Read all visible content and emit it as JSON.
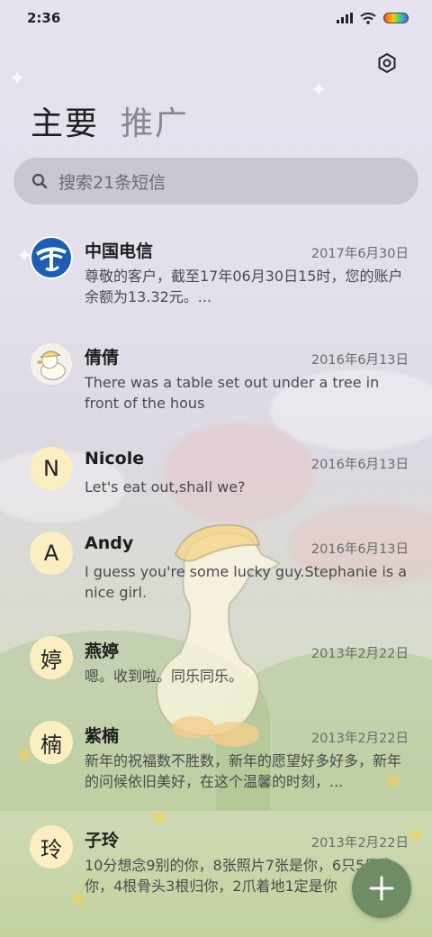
{
  "status_bar": {
    "time": "2:36"
  },
  "tabs": [
    {
      "label": "主要"
    },
    {
      "label": "推广"
    }
  ],
  "search": {
    "placeholder": "搜索21条短信"
  },
  "messages": [
    {
      "avatar_type": "logo",
      "avatar_icon": "china-telecom-logo",
      "name": "中国电信",
      "date": "2017年6月30日",
      "preview": "尊敬的客户，截至17年06月30日15时，您的账户余额为13.32元。..."
    },
    {
      "avatar_type": "picture",
      "avatar_icon": "duck-avatar",
      "name": "倩倩",
      "date": "2016年6月13日",
      "preview": "There was a table set out under a tree in front of the hous"
    },
    {
      "avatar_type": "letter",
      "avatar_letter": "N",
      "name": "Nicole",
      "date": "2016年6月13日",
      "preview": "Let's eat out,shall we?"
    },
    {
      "avatar_type": "letter",
      "avatar_letter": "A",
      "name": "Andy",
      "date": "2016年6月13日",
      "preview": "I guess you're some lucky guy.Stephanie is a nice girl."
    },
    {
      "avatar_type": "letter",
      "avatar_letter": "婷",
      "name": "燕婷",
      "date": "2013年2月22日",
      "preview": "嗯。收到啦。同乐同乐。"
    },
    {
      "avatar_type": "letter",
      "avatar_letter": "楠",
      "name": "紫楠",
      "date": "2013年2月22日",
      "preview": "新年的祝福数不胜数，新年的愿望好多好多，新年的问候依旧美好，在这个温馨的时刻，..."
    },
    {
      "avatar_type": "letter",
      "avatar_letter": "玲",
      "name": "子玲",
      "date": "2013年2月22日",
      "preview": "10分想念9别的你，8张照片7张是你，6只5只像你，4根骨头3根归你，2爪着地1定是你"
    }
  ],
  "colors": {
    "fab": "#6e8d67",
    "avatar_bg": "#fbeec0",
    "telecom_blue": "#1b5fb5"
  }
}
